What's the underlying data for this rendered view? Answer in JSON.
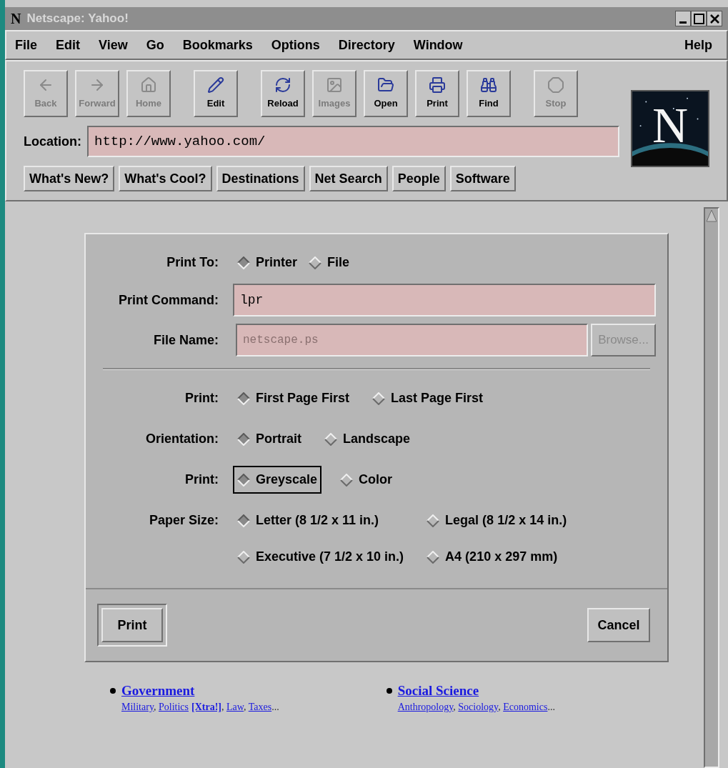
{
  "window": {
    "icon": "N",
    "title": "Netscape: Yahoo!"
  },
  "menu": [
    "File",
    "Edit",
    "View",
    "Go",
    "Bookmarks",
    "Options",
    "Directory",
    "Window"
  ],
  "help_menu": "Help",
  "toolbar": [
    {
      "label": "Back",
      "disabled": true
    },
    {
      "label": "Forward",
      "disabled": true
    },
    {
      "label": "Home",
      "disabled": true
    },
    {
      "label": "Edit",
      "disabled": false
    },
    {
      "label": "Reload",
      "disabled": false
    },
    {
      "label": "Images",
      "disabled": true
    },
    {
      "label": "Open",
      "disabled": false
    },
    {
      "label": "Print",
      "disabled": false
    },
    {
      "label": "Find",
      "disabled": false
    },
    {
      "label": "Stop",
      "disabled": true
    }
  ],
  "logo": "N",
  "location": {
    "label": "Location:",
    "value": "http://www.yahoo.com/"
  },
  "directory_buttons": [
    "What's New?",
    "What's Cool?",
    "Destinations",
    "Net Search",
    "People",
    "Software"
  ],
  "dialog": {
    "print_to": {
      "label": "Print To:",
      "options": [
        {
          "label": "Printer",
          "selected": true,
          "focused": false
        },
        {
          "label": "File",
          "selected": false,
          "focused": false
        }
      ]
    },
    "print_command": {
      "label": "Print Command:",
      "value": "lpr",
      "disabled": false
    },
    "file_name": {
      "label": "File Name:",
      "value": "netscape.ps",
      "disabled": true
    },
    "browse": {
      "label": "Browse...",
      "disabled": true
    },
    "groups": [
      {
        "label": "Print:",
        "options": [
          {
            "label": "First Page First",
            "selected": true,
            "focused": false
          },
          {
            "label": "Last Page First",
            "selected": false,
            "focused": false
          }
        ]
      },
      {
        "label": "Orientation:",
        "options": [
          {
            "label": "Portrait",
            "selected": true,
            "focused": false
          },
          {
            "label": "Landscape",
            "selected": false,
            "focused": false
          }
        ]
      },
      {
        "label": "Print:",
        "options": [
          {
            "label": "Greyscale",
            "selected": true,
            "focused": true
          },
          {
            "label": "Color",
            "selected": false,
            "focused": false
          }
        ]
      },
      {
        "label": "Paper Size:",
        "options": [
          {
            "label": "Letter (8 1/2 x 11 in.)",
            "selected": true,
            "focused": false
          },
          {
            "label": "Legal (8 1/2 x 14 in.)",
            "selected": false,
            "focused": false
          },
          {
            "label": "Executive (7 1/2 x 10 in.)",
            "selected": false,
            "focused": false
          },
          {
            "label": "A4 (210 x 297 mm)",
            "selected": false,
            "focused": false
          }
        ]
      }
    ],
    "buttons": {
      "ok": "Print",
      "cancel": "Cancel"
    }
  },
  "categories": [
    {
      "title": "Government",
      "sub": [
        {
          "kind": "link",
          "text": "Military"
        },
        {
          "kind": "text",
          "text": ", "
        },
        {
          "kind": "link",
          "text": "Politics"
        },
        {
          "kind": "boldlink",
          "text": "[Xtra!]"
        },
        {
          "kind": "text",
          "text": ", "
        },
        {
          "kind": "link",
          "text": "Law"
        },
        {
          "kind": "text",
          "text": ", "
        },
        {
          "kind": "link",
          "text": "Taxes"
        },
        {
          "kind": "text",
          "text": "..."
        }
      ]
    },
    {
      "title": "Social Science",
      "sub": [
        {
          "kind": "link",
          "text": "Anthropology"
        },
        {
          "kind": "text",
          "text": ", "
        },
        {
          "kind": "link",
          "text": "Sociology"
        },
        {
          "kind": "text",
          "text": ", "
        },
        {
          "kind": "link",
          "text": "Economics"
        },
        {
          "kind": "text",
          "text": "..."
        }
      ]
    }
  ]
}
